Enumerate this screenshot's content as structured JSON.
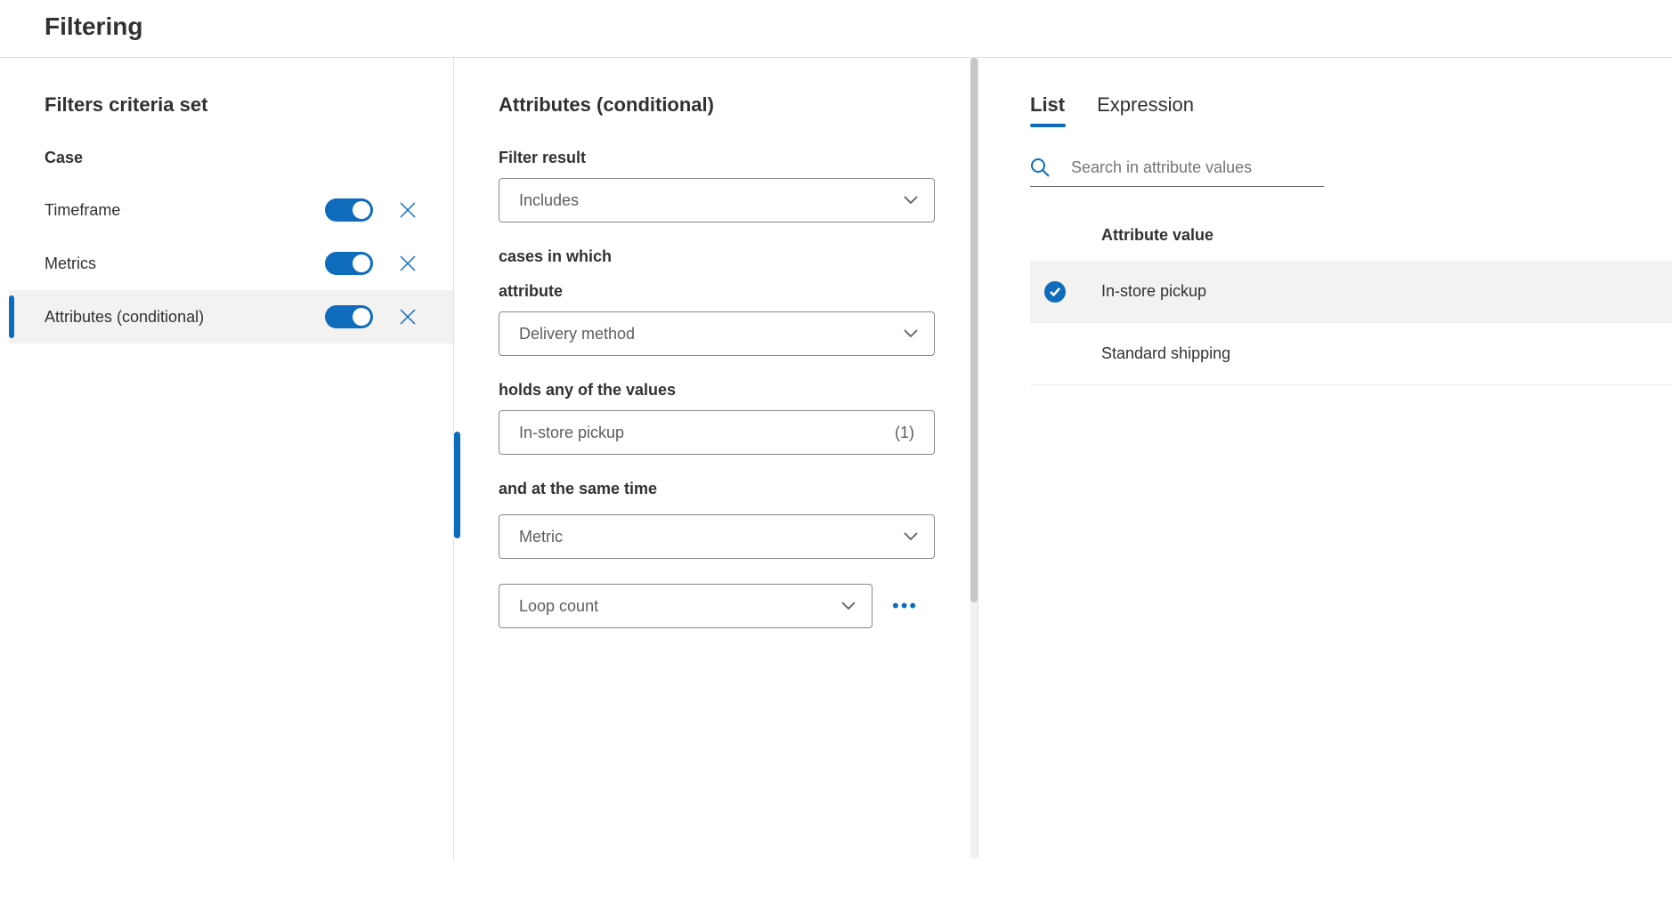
{
  "header": {
    "title": "Filtering"
  },
  "left": {
    "title": "Filters criteria set",
    "group": "Case",
    "items": [
      {
        "label": "Timeframe",
        "on": true,
        "selected": false
      },
      {
        "label": "Metrics",
        "on": true,
        "selected": false
      },
      {
        "label": "Attributes (conditional)",
        "on": true,
        "selected": true
      }
    ]
  },
  "center": {
    "title": "Attributes (conditional)",
    "filter_result_label": "Filter result",
    "filter_result_value": "Includes",
    "cases_in_which": "cases in which",
    "attribute_label": "attribute",
    "attribute_value": "Delivery method",
    "holds_label": "holds any of the values",
    "holds_value": "In-store pickup",
    "holds_count": "(1)",
    "same_time_label": "and at the same time",
    "same_time_value": "Metric",
    "loop_value": "Loop count"
  },
  "right": {
    "tabs": {
      "list": "List",
      "expression": "Expression"
    },
    "search_placeholder": "Search in attribute values",
    "attr_header": "Attribute value",
    "values": [
      {
        "label": "In-store pickup",
        "selected": true
      },
      {
        "label": "Standard shipping",
        "selected": false
      }
    ]
  }
}
